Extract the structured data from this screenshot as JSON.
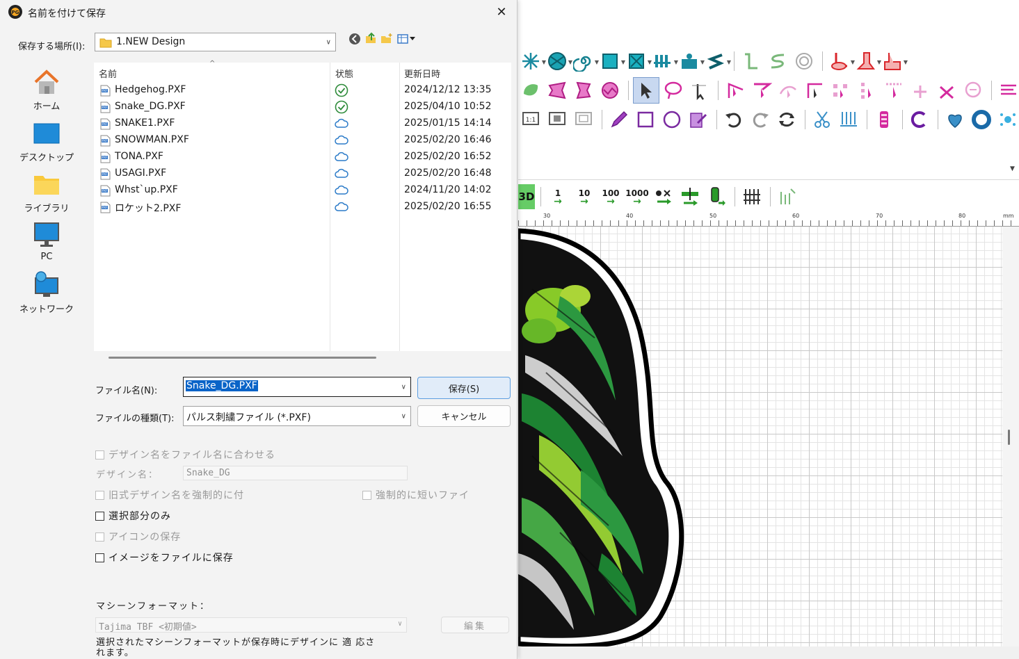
{
  "dialog": {
    "title": "名前を付けて保存",
    "close_glyph": "✕",
    "location_label": "保存する場所(I):",
    "location_value": "1.NEW Design",
    "places": [
      {
        "label": "ホーム",
        "icon": "home-icon"
      },
      {
        "label": "デスクトップ",
        "icon": "desktop-icon"
      },
      {
        "label": "ライブラリ",
        "icon": "library-folder-icon"
      },
      {
        "label": "PC",
        "icon": "pc-monitor-icon"
      },
      {
        "label": "ネットワーク",
        "icon": "network-icon"
      }
    ],
    "columns": {
      "name": "名前",
      "status": "状態",
      "modified": "更新日時"
    },
    "files": [
      {
        "name": "Hedgehog.PXF",
        "status": "synced",
        "modified": "2024/12/12 13:35"
      },
      {
        "name": "Snake_DG.PXF",
        "status": "synced",
        "modified": "2025/04/10 10:52"
      },
      {
        "name": "SNAKE1.PXF",
        "status": "cloud",
        "modified": "2025/01/15 14:14"
      },
      {
        "name": "SNOWMAN.PXF",
        "status": "cloud",
        "modified": "2025/02/20 16:46"
      },
      {
        "name": "TONA.PXF",
        "status": "cloud",
        "modified": "2025/02/20 16:52"
      },
      {
        "name": "USAGI.PXF",
        "status": "cloud",
        "modified": "2025/02/20 16:48"
      },
      {
        "name": "Whst`up.PXF",
        "status": "cloud",
        "modified": "2024/11/20 14:02"
      },
      {
        "name": "ロケット2.PXF",
        "status": "cloud",
        "modified": "2025/02/20 16:55"
      }
    ],
    "filename_label": "ファイル名(N):",
    "filename_value": "Snake_DG.PXF",
    "filetype_label": "ファイルの種類(T):",
    "filetype_value": "パルス刺繍ファイル (*.PXF)",
    "save_button": "保存(S)",
    "cancel_button": "キャンセル",
    "options": {
      "match_design_name": "デザイン名をファイル名に合わせる",
      "design_name_label": "デザイン名：",
      "design_name_value": "Snake_DG",
      "force_old_name": "旧式デザイン名を強制的に付",
      "force_short_name": "強制的に短いファイ",
      "selection_only": "選択部分のみ",
      "save_icon": "アイコンの保存",
      "save_image": "イメージをファイルに保存"
    },
    "machine_format_label": "マシーンフォーマット：",
    "machine_format_value": "Tajima TBF <初期値>",
    "edit_button": "編集",
    "machine_format_note": "選択されたマシーンフォーマットが保存時にデザインに 適 応されます。"
  },
  "app": {
    "stitch_buttons": [
      "1",
      "10",
      "100",
      "1000"
    ],
    "view_3d_label": "3D",
    "ruler_ticks": [
      "30",
      "40",
      "50",
      "60",
      "70",
      "80"
    ],
    "ruler_unit": "mm"
  },
  "colors": {
    "accent": "#0078d7",
    "selection": "#0a64c8",
    "icon_teal": "#1aa3a3",
    "icon_magenta": "#d42a9e",
    "icon_red": "#d9262b",
    "embroidery_green": "#2ea043"
  }
}
